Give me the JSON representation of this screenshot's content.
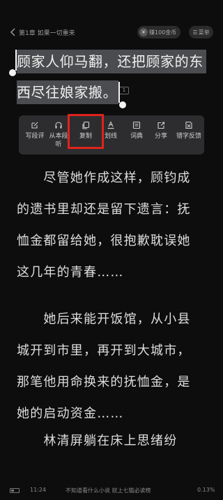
{
  "header": {
    "chapter_title": "第1章  如果一切重来",
    "coin_icon": "coin-icon",
    "coin_badge_icon_text": "¥",
    "coin_badge_label": "赚100金币",
    "menu_icon": "menu-icon",
    "menu_label": "菜单"
  },
  "selection": {
    "line1": "顾家人仰马翻，还把顾家的东",
    "line2": "西尽往娘家搬。",
    "comment_count": "1"
  },
  "toolbar": {
    "items": [
      {
        "icon": "edit-icon",
        "label": "写段评"
      },
      {
        "icon": "headphones-icon",
        "label": "从本段听"
      },
      {
        "icon": "copy-icon",
        "label": "复制"
      },
      {
        "icon": "underline-icon",
        "label": "划线"
      },
      {
        "icon": "dictionary-icon",
        "label": "词典"
      },
      {
        "icon": "share-icon",
        "label": "分享"
      },
      {
        "icon": "typo-report-icon",
        "label": "错字反馈"
      }
    ],
    "highlight_color": "#e0231c"
  },
  "body": {
    "lines": [
      "　　尽管她作成这样，顾钧成",
      "的遗书里却还是留下遗言：抚",
      "恤金都留给她，很抱歉耽误她",
      "这几年的青春……",
      "　　她后来能开饭馆，从小县",
      "城开到市里，再开到大城市，",
      "那笔他用命换来的抚恤金，是",
      "她的启动资金……",
      "　　林清屏躺在床上思绪纷"
    ]
  },
  "status": {
    "time": "11:24",
    "promo": "不知道看什么小说  就上七猫必读榜",
    "progress": "0.13%",
    "battery_level": 0.4
  },
  "colors": {
    "background": "#0d0d0d",
    "selection": "#4b4c4f",
    "toolbar": "#2d2d2f"
  }
}
